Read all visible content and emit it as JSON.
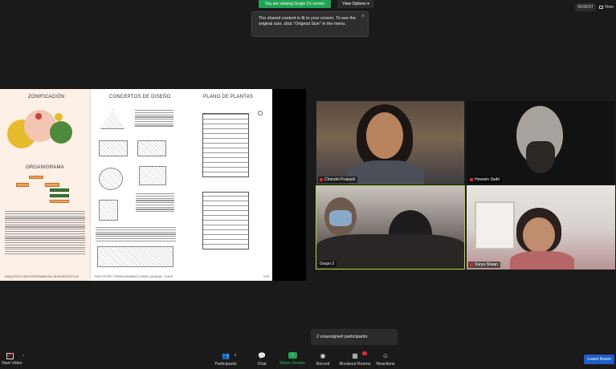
{
  "top": {
    "banner": "You are viewing Grupo 2's screen",
    "view_options": "View Options",
    "timer": "00:00:07",
    "view_label": "View"
  },
  "tooltip": {
    "text": "The shared content is fit to your screen. To see the original size, click \"Original Size\" in the menu."
  },
  "slide": {
    "col1_title": "ZONIFICACIÓN",
    "col1_subtitle": "ORGANIGRAMA",
    "col2_title": "CONCEPTOS DE DISEÑO",
    "col3_title": "PLANO DE PLANTAS",
    "footer_left": "ARQUITECTURA EXPERIMENTAL BIOENERGÉTICA",
    "footer_center": "PROTOTIPO TERMODINÁMICO PARA IQUIQUE, CHILE",
    "page": "2/25"
  },
  "participants": [
    {
      "name": "Chandni Prakash"
    },
    {
      "name": "Hossein Sadri"
    },
    {
      "name": "Grupo 2"
    },
    {
      "name": "Surya Shaan"
    }
  ],
  "unassigned": "2 unassigned participants",
  "toolbar": {
    "start_video": "Start Video",
    "participants": "Participants",
    "participants_count": "4",
    "chat": "Chat",
    "share_screen": "Share Screen",
    "record": "Record",
    "breakout_rooms": "Breakout Rooms",
    "reactions": "Reactions",
    "leave": "Leave Room"
  },
  "colors": {
    "share_green": "#23a455",
    "leave_blue": "#1f5fc8",
    "active_speaker": "#b5d33d",
    "muted_red": "#e02828"
  }
}
